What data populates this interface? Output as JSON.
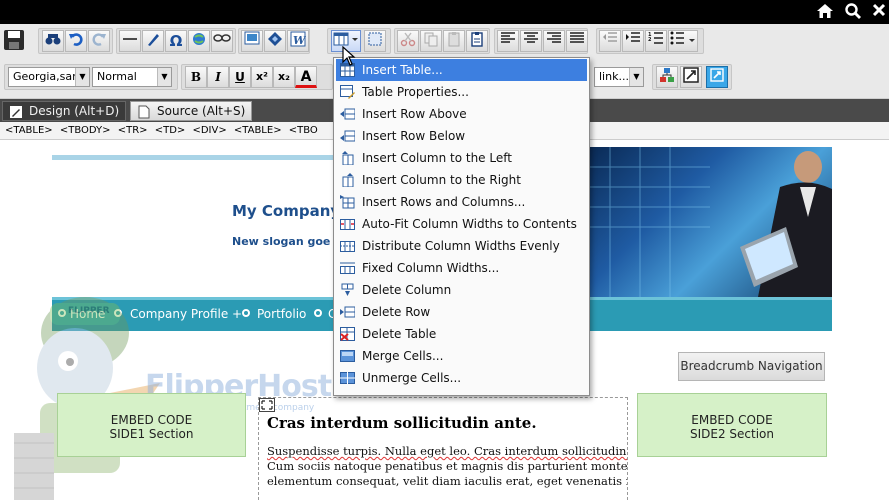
{
  "topbar": {
    "icons": [
      "home-icon",
      "search-icon",
      "close-icon"
    ]
  },
  "toolbar": {
    "font_family": "Georgia,san",
    "paragraph_style": "Normal",
    "link_select": "link...",
    "buttons": {
      "bold": "B",
      "italic": "I",
      "underline": "U",
      "superscript": "x²",
      "subscript": "x₂",
      "font_color": "A"
    }
  },
  "tabs": {
    "design": "Design (Alt+D)",
    "source": "Source (Alt+S)"
  },
  "tag_path": "<TABLE> <TBODY> <TR> <TD> <DIV> <TABLE> <TBO",
  "page": {
    "company_name": "My Company",
    "slogan": "New slogan goe",
    "nav_items": [
      "Home",
      "Company Profile +",
      "Portfolio",
      "C"
    ],
    "breadcrumb_button": "Breadcrumb Navigation",
    "logo_text": "FlipperHost",
    "logo_subtext": "an investment company",
    "mascot_cap_text": "FLIPPER",
    "side1": {
      "line1": "EMBED CODE",
      "line2": "SIDE1 Section"
    },
    "side2": {
      "line1": "EMBED CODE",
      "line2": "SIDE2 Section"
    },
    "article_title": "Cras interdum sollicitudin ante.",
    "article_lines": [
      "Suspendisse turpis. Nulla eget leo. Cras interdum sollicitudin a",
      "Cum sociis natoque penatibus et magnis dis parturient montes",
      "elementum consequat, velit diam iaculis erat, eget venenatis n"
    ]
  },
  "table_menu": {
    "items": [
      {
        "label": "Insert Table...",
        "icon": "insert-table-icon",
        "active": true
      },
      {
        "label": "Table Properties...",
        "icon": "table-properties-icon"
      },
      {
        "label": "Insert Row Above",
        "icon": "insert-row-above-icon"
      },
      {
        "label": "Insert Row Below",
        "icon": "insert-row-below-icon"
      },
      {
        "label": "Insert Column to the Left",
        "icon": "insert-column-left-icon"
      },
      {
        "label": "Insert Column to the Right",
        "icon": "insert-column-right-icon"
      },
      {
        "label": "Insert Rows and Columns...",
        "icon": "insert-rows-columns-icon"
      },
      {
        "label": "Auto-Fit Column Widths to Contents",
        "icon": "autofit-columns-icon"
      },
      {
        "label": "Distribute Column Widths Evenly",
        "icon": "distribute-columns-icon"
      },
      {
        "label": "Fixed Column Widths...",
        "icon": "fixed-columns-icon"
      },
      {
        "label": "Delete Column",
        "icon": "delete-column-icon"
      },
      {
        "label": "Delete Row",
        "icon": "delete-row-icon"
      },
      {
        "label": "Delete Table",
        "icon": "delete-table-icon"
      },
      {
        "label": "Merge Cells...",
        "icon": "merge-cells-icon"
      },
      {
        "label": "Unmerge Cells...",
        "icon": "unmerge-cells-icon"
      }
    ]
  },
  "colors": {
    "nav_bar": "#2b9bb4",
    "menu_highlight": "#3d7fe0",
    "company_name": "#1e4f8c",
    "embed_box_bg": "#d6f1c8",
    "embed_box_border": "#a8d196"
  }
}
